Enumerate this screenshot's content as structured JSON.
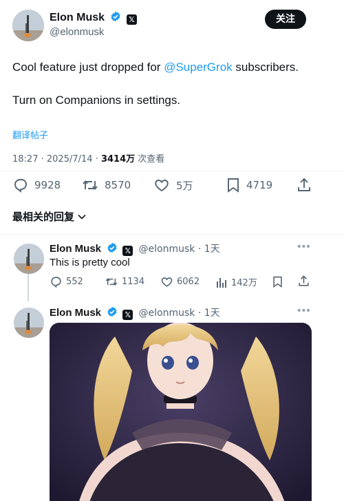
{
  "main_tweet": {
    "author_name": "Elon Musk",
    "handle": "@elonmusk",
    "follow_label": "关注",
    "text_line1_prefix": "Cool feature just dropped for ",
    "text_mention": "@SuperGrok",
    "text_line1_suffix": " subscribers.",
    "text_line2": "Turn on Companions in settings.",
    "translate_label": "翻译帖子",
    "time": "18:27",
    "date": "2025/7/14",
    "views_count": "3414万",
    "views_label": " 次查看",
    "stats": {
      "replies": "9928",
      "reposts": "8570",
      "likes": "5万",
      "bookmarks": "4719"
    }
  },
  "sort_label": "最相关的回复",
  "replies": [
    {
      "author_name": "Elon Musk",
      "handle": "@elonmusk",
      "age": "1天",
      "text": "This is pretty cool",
      "stats": {
        "replies": "552",
        "reposts": "1134",
        "likes": "6062",
        "views": "142万"
      }
    },
    {
      "author_name": "Elon Musk",
      "handle": "@elonmusk",
      "age": "1天"
    }
  ],
  "icons": {
    "verified": "verified-badge-icon",
    "x_affiliate": "x-logo-icon",
    "reply": "reply-icon",
    "repost": "repost-icon",
    "like": "heart-icon",
    "bookmark": "bookmark-icon",
    "share": "share-icon",
    "views": "views-bar-chart-icon",
    "more": "more-dots-icon",
    "sort": "chevron-down-icon"
  },
  "colors": {
    "accent": "#1d9bf0",
    "text": "#0f1419",
    "secondary": "#536471",
    "divider": "#eff3f4"
  }
}
